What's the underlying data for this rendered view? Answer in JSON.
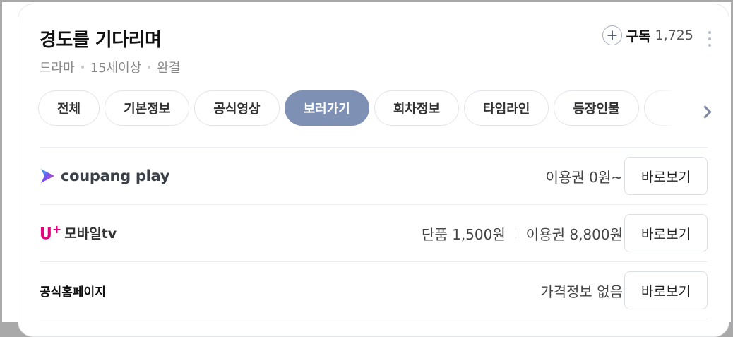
{
  "title": "경도를 기다리며",
  "meta": {
    "genre": "드라마",
    "rating": "15세이상",
    "status": "완결"
  },
  "subscribe": {
    "label": "구독",
    "count": "1,725"
  },
  "tabs": [
    {
      "label": "전체",
      "active": false
    },
    {
      "label": "기본정보",
      "active": false
    },
    {
      "label": "공식영상",
      "active": false
    },
    {
      "label": "보러가기",
      "active": true
    },
    {
      "label": "회차정보",
      "active": false
    },
    {
      "label": "타임라인",
      "active": false
    },
    {
      "label": "등장인물",
      "active": false
    }
  ],
  "providers": [
    {
      "name": "coupang play",
      "price_1": "이용권 0원~",
      "price_2": "",
      "button": "바로보기"
    },
    {
      "name": "모바일tv",
      "logo_prefix": "U",
      "price_1": "단품 1,500원",
      "price_2": "이용권 8,800원",
      "button": "바로보기"
    },
    {
      "name": "공식홈페이지",
      "price_1": "가격정보 없음",
      "price_2": "",
      "button": "바로보기"
    }
  ],
  "colors": {
    "active_tab": "#7f90b5",
    "uplus_magenta": "#e5007e"
  },
  "icons": {
    "subscribe": "plus-circle-icon",
    "more": "kebab-menu-icon",
    "next": "chevron-right-icon",
    "coupang": "coupang-play-logo-icon"
  }
}
